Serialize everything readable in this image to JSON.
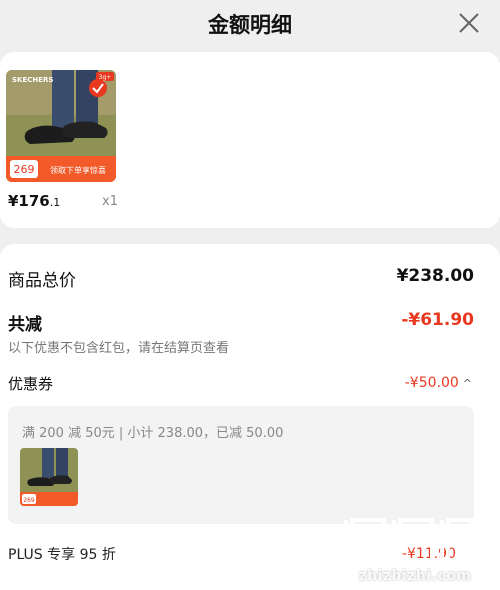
{
  "header": {
    "title": "金额明细",
    "close_icon": "close-icon"
  },
  "product": {
    "price_main": "¥176",
    "price_decimal": ".1",
    "qty": "x1",
    "thumb": {
      "brand_logo": "SKECHERS",
      "badge_text": "3g+",
      "price_tag": "269",
      "banner_text": "领取下单享惊喜"
    }
  },
  "summary": {
    "total_label": "商品总价",
    "total_value": "¥238.00",
    "reduce_label": "共减",
    "reduce_value": "-¥61.90",
    "reduce_note": "以下优惠不包含红包，请在结算页查看",
    "coupon_label": "优惠券",
    "coupon_value": "-¥50.00",
    "coupon_desc": "满 200 减 50元 | 小计 238.00，已减 50.00",
    "coupon_thumb_price": "269",
    "plus_label": "PLUS 专享 95 折",
    "plus_value": "-¥11.90"
  },
  "watermark": {
    "text": "zhizhizhi.com"
  },
  "colors": {
    "accent": "#e8381f",
    "background": "#efefef",
    "card": "#ffffff"
  }
}
